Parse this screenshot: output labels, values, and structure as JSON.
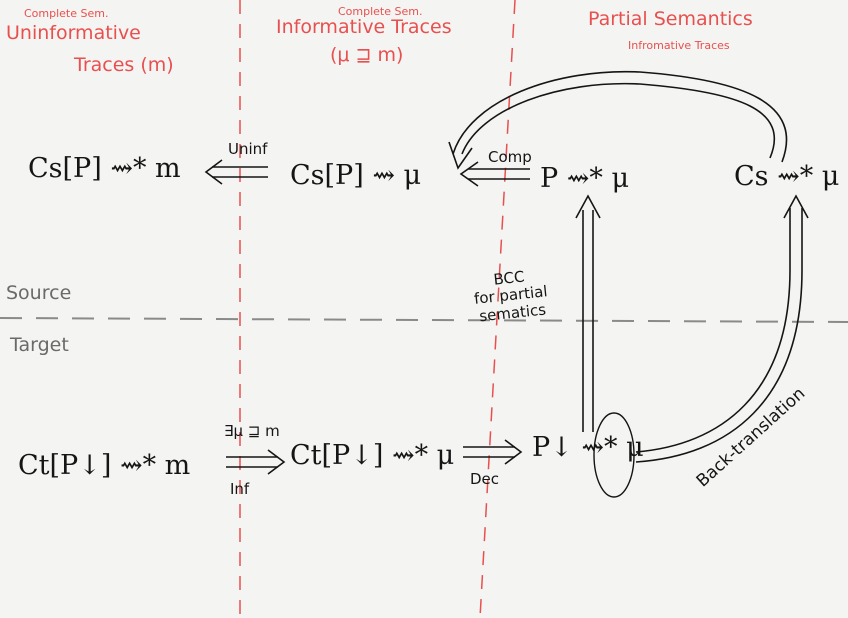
{
  "columns": [
    {
      "small": "Complete Sem.",
      "title_lines": [
        "Uninformative",
        "Traces (m)"
      ]
    },
    {
      "small": "Complete Sem.",
      "title_lines": [
        "Informative Traces",
        "(μ ⊒ m)"
      ]
    },
    {
      "small": "Infromative Traces",
      "title_lines": [
        "Partial Semantics"
      ]
    }
  ],
  "regions": {
    "source": "Source",
    "target": "Target"
  },
  "source_row": {
    "f1": "Cs[P] ⇝* m",
    "f2": "Cs[P] ⇝ μ",
    "f3": "P ⇝* μ",
    "f4": "Cs ⇝* μ",
    "arrow_uninf": "Uninf",
    "arrow_comp": "Comp"
  },
  "target_row": {
    "f1": "Ct[P↓] ⇝* m",
    "f2": "Ct[P↓] ⇝* μ",
    "f3": "P↓ ⇝* μ",
    "arrow_inf_top": "∃μ ⊒ m",
    "arrow_inf_bottom": "Inf",
    "arrow_dec": "Dec"
  },
  "bcc_label_lines": [
    "BCC",
    "for partial",
    "sematics"
  ],
  "back_translation_label": "Back-translation",
  "colors": {
    "ink": "#151515",
    "red": "#e8504f",
    "divider": "#8a8a8a",
    "paper": "#f4f4f2"
  }
}
